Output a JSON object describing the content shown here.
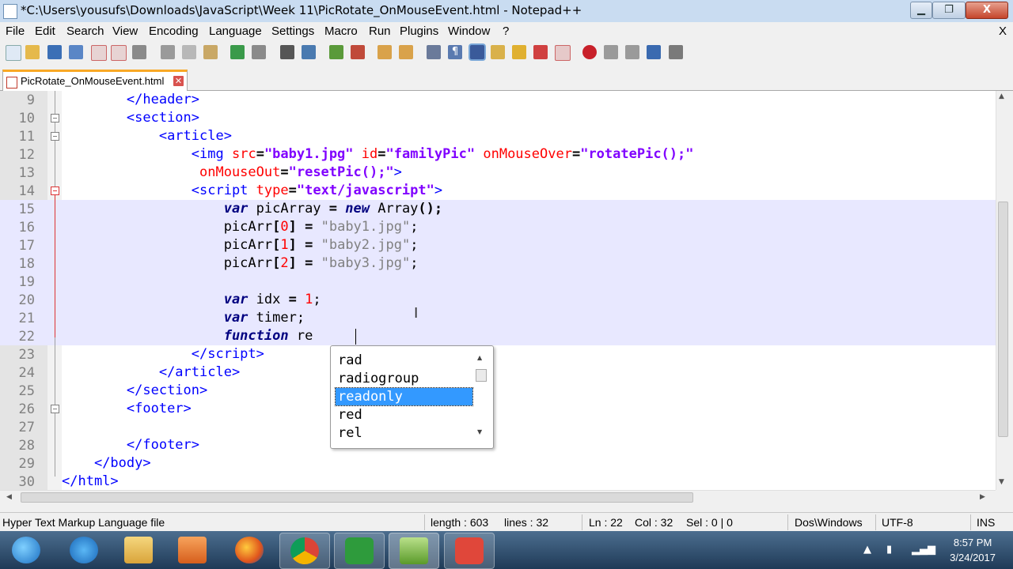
{
  "window": {
    "title": "*C:\\Users\\yousufs\\Downloads\\JavaScript\\Week 11\\PicRotate_OnMouseEvent.html - Notepad++",
    "minimize": "▁",
    "maximize": "❐",
    "close": "X"
  },
  "menu": [
    "File",
    "Edit",
    "Search",
    "View",
    "Encoding",
    "Language",
    "Settings",
    "Macro",
    "Run",
    "Plugins",
    "Window",
    "?"
  ],
  "menu_close": "X",
  "tab": {
    "label": "PicRotate_OnMouseEvent.html",
    "close": "✕"
  },
  "editor": {
    "line_numbers": [
      "9",
      "10",
      "11",
      "12",
      "13",
      "14",
      "15",
      "16",
      "17",
      "18",
      "19",
      "20",
      "21",
      "22",
      "23",
      "24",
      "25",
      "26",
      "27",
      "28",
      "29",
      "30"
    ],
    "highlighted_lines": [
      "15",
      "16",
      "17",
      "18",
      "19",
      "20",
      "21",
      "22"
    ],
    "current_line": "22",
    "typed_text": "re"
  },
  "autocomplete": {
    "items": [
      "rad",
      "radiogroup",
      "readonly",
      "red",
      "rel"
    ],
    "selected": "readonly"
  },
  "status": {
    "file_type": "Hyper Text Markup Language file",
    "length": "length : 603",
    "lines": "lines : 32",
    "ln": "Ln : 22",
    "col": "Col : 32",
    "sel": "Sel : 0 | 0",
    "eol": "Dos\\Windows",
    "encoding": "UTF-8",
    "mode": "INS"
  },
  "clock": {
    "time": "8:57 PM",
    "date": "3/24/2017"
  },
  "colors": {
    "tag": "#0000ff",
    "attribute": "#ff0000",
    "attr_value": "#8000ff",
    "keyword": "#000080",
    "string": "#808080",
    "selection": "#3399ff"
  }
}
